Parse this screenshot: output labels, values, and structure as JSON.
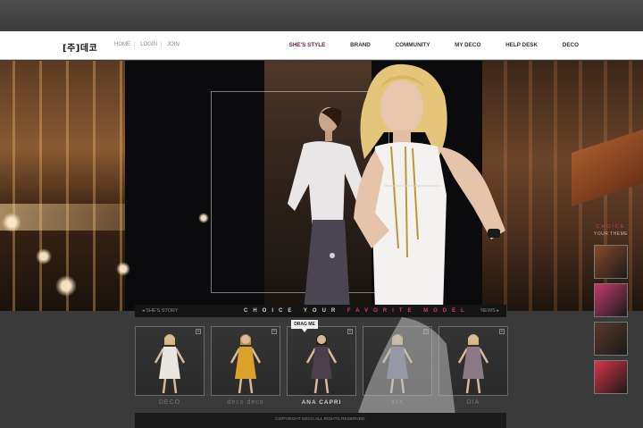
{
  "header": {
    "logo": "[주]데코",
    "utility_links": [
      "HOME",
      "LOGIN",
      "JOIN"
    ],
    "nav": [
      {
        "label": "SHE'S STYLE",
        "active": true
      },
      {
        "label": "BRAND",
        "active": false
      },
      {
        "label": "COMMUNITY",
        "active": false
      },
      {
        "label": "MY DECO",
        "active": false
      },
      {
        "label": "HELP DESK",
        "active": false
      },
      {
        "label": "DECO",
        "active": false
      }
    ]
  },
  "choice_bar": {
    "prev": "◂ SHE'S STORY",
    "title_prefix": "CHOICE  YOUR",
    "title_highlight": "FAVORITE MODEL",
    "next": "NEWS ▸"
  },
  "drag_tag": "DRAG ME",
  "models": [
    {
      "label": "DECO",
      "outfit": "#e9e6e0"
    },
    {
      "label": "deco.deco",
      "outfit": "#d9a12a"
    },
    {
      "label": "ANA CAPRI",
      "outfit": "#4a3f4a",
      "active": true
    },
    {
      "label": "XIX",
      "outfit": "#6a6d8a"
    },
    {
      "label": "DIA",
      "outfit": "#8a7a86"
    }
  ],
  "side_panel": {
    "title": "CHOICE",
    "subtitle": "YOUR THEME",
    "colors": [
      "#8a4a2a",
      "#c23b6a",
      "#5a3a2a",
      "#d8354a"
    ]
  },
  "footer": {
    "copyright": "COPYRIGHT DECO ALL RIGHTS RESERVED."
  },
  "colors": {
    "accent": "#d8356b",
    "nav_active": "#6b1a4a"
  }
}
